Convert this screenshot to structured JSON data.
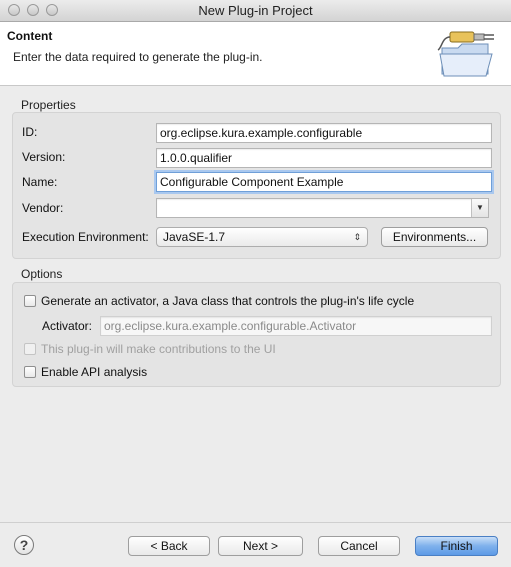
{
  "window": {
    "title": "New Plug-in Project"
  },
  "header": {
    "title": "Content",
    "description": "Enter the data required to generate the plug-in.",
    "icon": "plugin-folder-icon"
  },
  "properties": {
    "group_label": "Properties",
    "id_label": "ID:",
    "id_value": "org.eclipse.kura.example.configurable",
    "version_label": "Version:",
    "version_value": "1.0.0.qualifier",
    "name_label": "Name:",
    "name_value": "Configurable Component Example",
    "vendor_label": "Vendor:",
    "vendor_value": "",
    "env_label": "Execution Environment:",
    "env_value": "JavaSE-1.7",
    "environments_button": "Environments..."
  },
  "options": {
    "group_label": "Options",
    "generate_activator_label": "Generate an activator, a Java class that controls the plug-in's life cycle",
    "generate_activator_checked": false,
    "activator_label": "Activator:",
    "activator_value": "org.eclipse.kura.example.configurable.Activator",
    "ui_contributions_label": "This plug-in will make contributions to the UI",
    "ui_contributions_checked": false,
    "api_analysis_label": "Enable API analysis",
    "api_analysis_checked": false
  },
  "footer": {
    "help_icon": "help-icon",
    "help_glyph": "?",
    "back_label": "< Back",
    "next_label": "Next >",
    "cancel_label": "Cancel",
    "finish_label": "Finish"
  },
  "colors": {
    "default_button": "#5d9ae6",
    "focus_ring": "#a9c8ef"
  }
}
